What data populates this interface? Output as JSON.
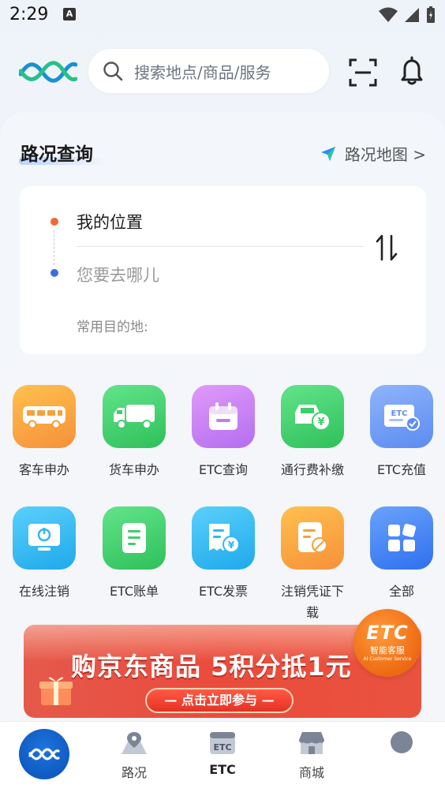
{
  "status_bar": {
    "time": "2:29",
    "notification_letter": "A"
  },
  "header": {
    "search_placeholder": "搜索地点/商品/服务"
  },
  "traffic": {
    "title": "路况查询",
    "map_link": "路况地图 >",
    "origin": "我的位置",
    "destination_placeholder": "您要去哪儿",
    "common_destinations_label": "常用目的地:"
  },
  "services": [
    {
      "label": "客车申办",
      "icon": "bus-icon",
      "color": "#f6a13a"
    },
    {
      "label": "货车申办",
      "icon": "truck-icon",
      "color": "#3fcf6a"
    },
    {
      "label": "ETC查询",
      "icon": "calendar-icon",
      "color": "#c07ef0"
    },
    {
      "label": "通行费补缴",
      "icon": "car-payment-icon",
      "color": "#3fcf6a"
    },
    {
      "label": "ETC充值",
      "icon": "etc-card-icon",
      "color": "#5d8ef5"
    },
    {
      "label": "在线注销",
      "icon": "monitor-power-icon",
      "color": "#2fb8ef"
    },
    {
      "label": "ETC账单",
      "icon": "document-icon",
      "color": "#3fcf6a"
    },
    {
      "label": "ETC发票",
      "icon": "invoice-icon",
      "color": "#2fb8ef"
    },
    {
      "label": "注销凭证下载",
      "icon": "certificate-icon",
      "color": "#f6a13a"
    },
    {
      "label": "全部",
      "icon": "all-apps-icon",
      "color": "#3b7cf0"
    }
  ],
  "banner": {
    "headline": "购京东商品 5积分抵1元",
    "cta": "— 点击立即参与 —",
    "badge_logo": "ETC",
    "badge_cn": "智能客服",
    "badge_en": "AI Customer Service"
  },
  "bottom_nav": [
    {
      "label": "路况"
    },
    {
      "label": "ETC"
    },
    {
      "label": "商城"
    }
  ],
  "colors": {
    "accent": "#1766d1",
    "brand_orange": "#f06a35"
  }
}
